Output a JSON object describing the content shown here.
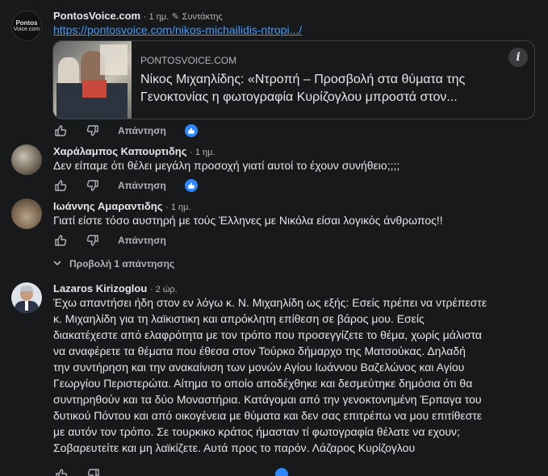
{
  "post": {
    "author": "PontosVoice.com",
    "time": "1 ημ.",
    "role": "Συντάκτης",
    "avatar_text_1": "Pontos",
    "avatar_text_2": "Voice.com",
    "link": "https://pontosvoice.com/nikos-michailidis-ntropi.../",
    "card": {
      "domain": "PONTOSVOICE.COM",
      "title_line1": "Νίκος Μιχαηλίδης: «Ντροπή – Προσβολή στα θύματα της",
      "title_line2": "Γενοκτονίας η φωτογραφία Κυρίζογλου μπροστά στον..."
    },
    "reply_label": "Απάντηση"
  },
  "comments": [
    {
      "author": "Χαράλαμπος Καπουρτιδης",
      "time": "1 ημ.",
      "text": "Δεν είπαμε ότι θέλει μεγάλη προσοχή γιατί αυτοί το έχουν συνήθειο;;;;",
      "reply_label": "Απάντηση",
      "has_reaction": true
    },
    {
      "author": "Ιωάννης Αμαραντιδης",
      "time": "1 ημ.",
      "text": "Γιατί είστε τόσο αυστηρή με τούς Έλληνες με Νικόλα είσαι λογικός άνθρωπος!!",
      "reply_label": "Απάντηση",
      "has_reaction": false
    }
  ],
  "view_replies": "Προβολή 1 απάντησης",
  "reply_comment": {
    "author": "Lazaros Kirizoglou",
    "time": "2 ώρ.",
    "lines": [
      "Έχω απαντήσει ήδη στον εν λόγω κ. Ν. Μιχαηλίδη ως εξής: Εσείς πρέπει να ντρέπεστε",
      "κ. Μιχαηλίδη για τη λαϊκιστικη και απρόκλητη επίθεση σε βάρος μου. Εσείς",
      "διακατέχεστε από ελαφρότητα με τον τρόπο που προσεγγίζετε το θέμα, χωρίς μάλιστα",
      "να αναφέρετε τα θέματα που έθεσα στον Τούρκο δήμαρχο της Ματσούκας. Δηλαδή",
      "την συντήρηση και την ανακαίνιση των μονών Αγίου Ιωάννου Βαζελώνος και Αγίου",
      "Γεωργίου Περιστερώτα. Αίτημα το οποίο αποδέχθηκε και δεσμεύτηκε δημόσια ότι θα",
      "συντηρηθούν και τα δύο Μοναστήρια. Κατάγομαι από την γενοκτονημένη Έρπαγα του",
      "δυτικού Πόντου και από οικογένεια με θύματα και δεν σας επιτρέπω να μου επιτίθεστε",
      "με αυτόν τον τρόπο. Σε τουρκικο κράτος ήμασταν τί φωτογραφία θέλατε να εχουν;",
      "Σοβαρευτείτε και μη λαϊκίζετε. Αυτά προς το παρόν. Λάζαρος Κυρίζογλου"
    ]
  },
  "colors": {
    "background": "#18191a",
    "text": "#e4e6eb",
    "secondary": "#b0b3b8",
    "link": "#4599ff",
    "like_blue": "#2d88ff"
  }
}
